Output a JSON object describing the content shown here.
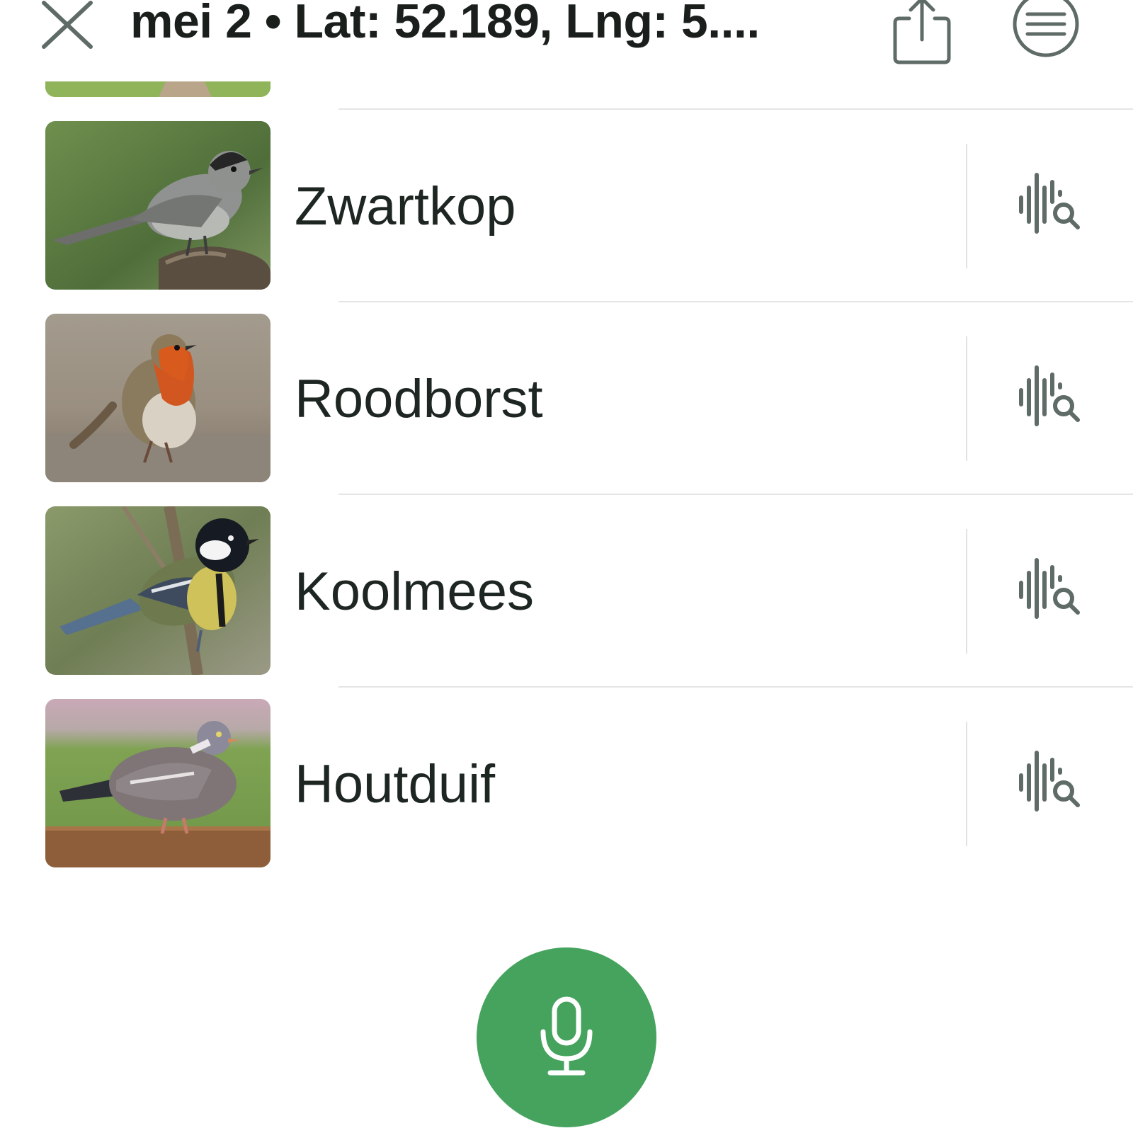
{
  "header": {
    "title": "mei 2 • Lat: 52.189, Lng: 5....",
    "close_icon": "close-icon",
    "share_icon": "share-icon",
    "menu_icon": "menu-icon"
  },
  "species_list": [
    {
      "name": "Zwartkop",
      "image": "blackcap-photo",
      "action_icon": "sound-search-icon"
    },
    {
      "name": "Roodborst",
      "image": "robin-photo",
      "action_icon": "sound-search-icon"
    },
    {
      "name": "Koolmees",
      "image": "great-tit-photo",
      "action_icon": "sound-search-icon"
    },
    {
      "name": "Houtduif",
      "image": "wood-pigeon-photo",
      "action_icon": "sound-search-icon"
    }
  ],
  "record_button": {
    "icon": "microphone-icon",
    "color": "#45a35d"
  },
  "colors": {
    "accent_green": "#45a35d",
    "icon_gray": "#5f6b66",
    "text": "#1f2522",
    "divider": "#e5e5e5"
  }
}
